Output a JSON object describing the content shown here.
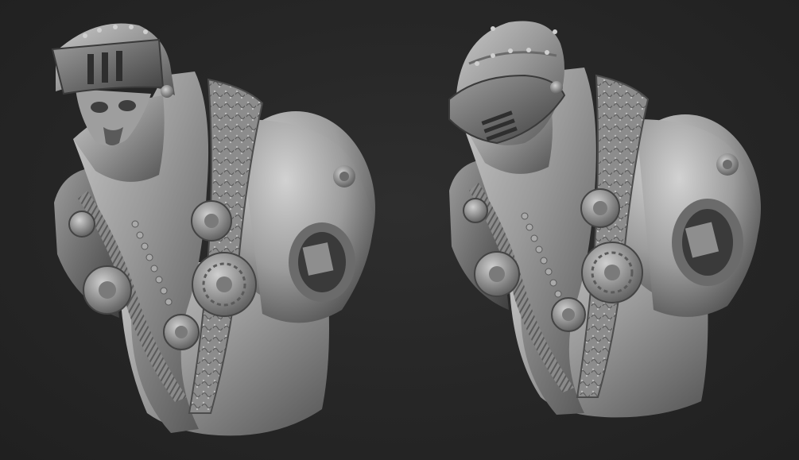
{
  "scene": {
    "background": "#262626",
    "material_light": "#b4b4b4",
    "material_mid": "#8a8a8a",
    "material_dark": "#4a4a4a",
    "models": [
      {
        "variant": "visor-raised",
        "helmet": "open-visor-face-visible"
      },
      {
        "variant": "visor-lowered",
        "helmet": "closed-visor"
      }
    ]
  }
}
